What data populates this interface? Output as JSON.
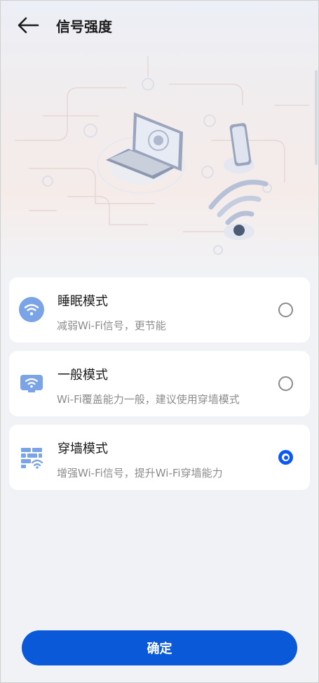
{
  "header": {
    "title": "信号强度",
    "back_icon": "arrow-left-icon"
  },
  "illustration": {
    "icon": "laptop-phone-wifi-illustration"
  },
  "modes": [
    {
      "title": "睡眠模式",
      "desc": "减弱Wi-Fi信号，更节能",
      "icon": "wifi-low-icon",
      "selected": false
    },
    {
      "title": "一般模式",
      "desc": "Wi-Fi覆盖能力一般，建议使用穿墙模式",
      "icon": "monitor-wifi-icon",
      "selected": false
    },
    {
      "title": "穿墙模式",
      "desc": "增强Wi-Fi信号，提升Wi-Fi穿墙能力",
      "icon": "wall-wifi-icon",
      "selected": true
    }
  ],
  "confirm_label": "确定",
  "colors": {
    "accent": "#0a59f7",
    "button": "#0a59d9",
    "icon_blue": "#7aa4e6",
    "background": "#f1f2f5"
  }
}
